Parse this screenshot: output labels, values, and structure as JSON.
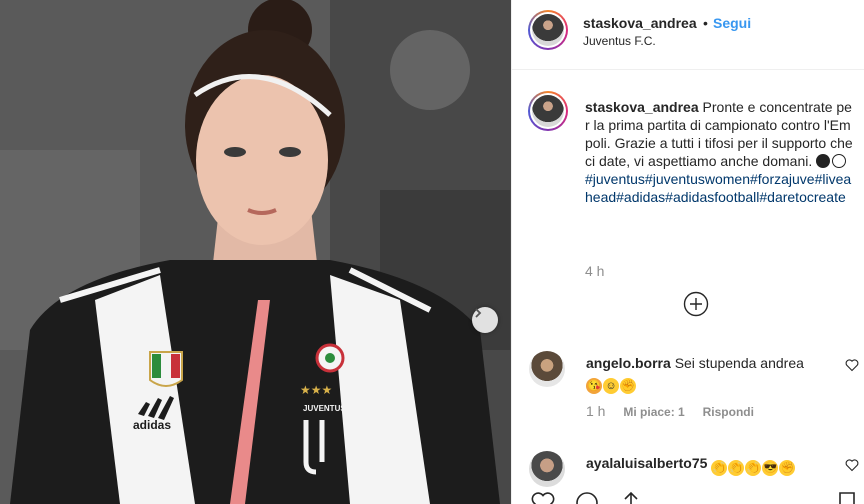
{
  "post": {
    "username": "staskova_andrea",
    "separator": "•",
    "follow_label": "Segui",
    "location": "Juventus F.C."
  },
  "caption": {
    "username": "staskova_andrea",
    "text": "Pronte e concentrate per la prima partita di campionato contro l'Empoli. Grazie a tutti i tifosi per il supporto che ci date, vi aspettiamo anche domani.",
    "hashtags": "#juventus#juventuswomen#forzajuve#liveahead#adidas#adidasfootball#daretocreate",
    "time": "4 h"
  },
  "comments": [
    {
      "username": "angelo.borra",
      "text": "Sei stupenda andrea",
      "emojis": [
        "kiss-emoji",
        "smile-emoji",
        "muscle-emoji"
      ],
      "time": "1 h",
      "likes": "Mi piace: 1",
      "reply": "Rispondi"
    },
    {
      "username": "ayalaluisalberto75",
      "text": "",
      "emojis": [
        "clap-emoji",
        "clap-emoji",
        "clap-emoji",
        "sunglasses-emoji",
        "muscle-emoji"
      ]
    }
  ],
  "photo": {
    "kit_text": "JUVENTUS",
    "sponsor_text": "adidas"
  },
  "colors": {
    "accent": "#3897f0",
    "hashtag": "#00376b",
    "muted": "#8e8e8e"
  }
}
